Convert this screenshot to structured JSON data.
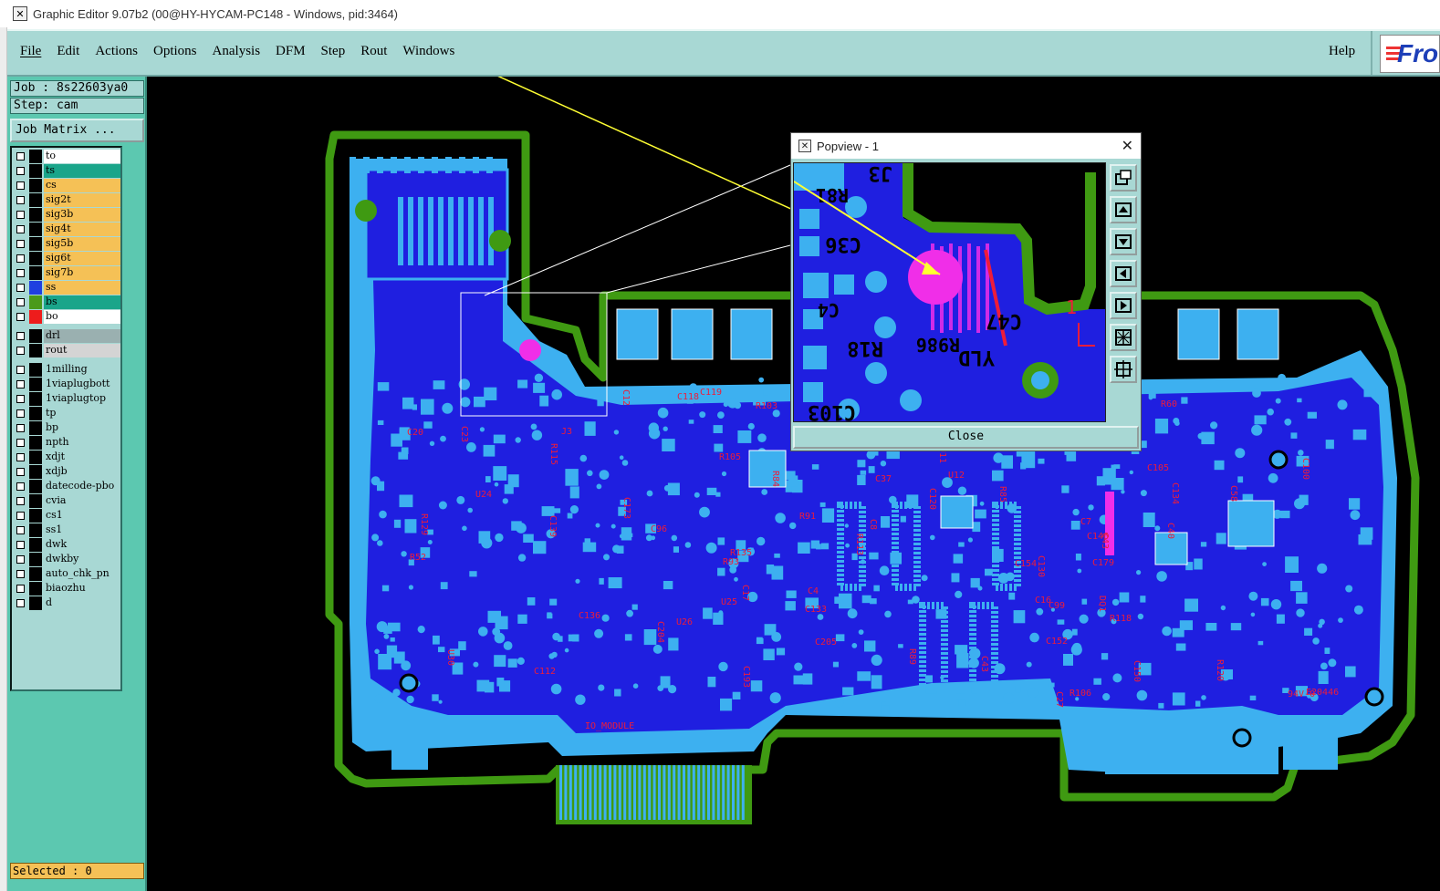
{
  "window": {
    "title": "Graphic Editor 9.07b2 (00@HY-HYCAM-PC148 - Windows, pid:3464)"
  },
  "menu": {
    "items": [
      "File",
      "Edit",
      "Actions",
      "Options",
      "Analysis",
      "DFM",
      "Step",
      "Rout",
      "Windows"
    ],
    "help": "Help",
    "logo_text": "Fro"
  },
  "info": {
    "job": "Job : 8s22603ya0",
    "step": "Step: cam",
    "job_matrix": "Job Matrix ..."
  },
  "layers": [
    {
      "name": "to",
      "color": "#ffffff"
    },
    {
      "name": "ts",
      "color": "#1aa58a"
    },
    {
      "name": "cs",
      "color": "#f5c156"
    },
    {
      "name": "sig2t",
      "color": "#f5c156"
    },
    {
      "name": "sig3b",
      "color": "#f5c156"
    },
    {
      "name": "sig4t",
      "color": "#f5c156"
    },
    {
      "name": "sig5b",
      "color": "#f5c156"
    },
    {
      "name": "sig6t",
      "color": "#f5c156"
    },
    {
      "name": "sig7b",
      "color": "#f5c156"
    },
    {
      "name": "ss",
      "color": "#f5c156",
      "swatch": "#1f3fe0"
    },
    {
      "name": "bs",
      "color": "#1aa58a",
      "swatch": "#4a9a1a"
    },
    {
      "name": "bo",
      "color": "#ffffff",
      "swatch": "#ee1c1c"
    },
    {
      "name": "drl",
      "color": "#9ab0b0"
    },
    {
      "name": "rout",
      "color": "#d4d4d4"
    },
    {
      "name": "1milling",
      "color": "#a8d8d4"
    },
    {
      "name": "1viaplugbott",
      "color": "#a8d8d4"
    },
    {
      "name": "1viaplugtop",
      "color": "#a8d8d4"
    },
    {
      "name": "tp",
      "color": "#a8d8d4"
    },
    {
      "name": "bp",
      "color": "#a8d8d4"
    },
    {
      "name": "npth",
      "color": "#a8d8d4"
    },
    {
      "name": "xdjt",
      "color": "#a8d8d4"
    },
    {
      "name": "xdjb",
      "color": "#a8d8d4"
    },
    {
      "name": "datecode-pbo",
      "color": "#a8d8d4"
    },
    {
      "name": "cvia",
      "color": "#a8d8d4"
    },
    {
      "name": "cs1",
      "color": "#a8d8d4"
    },
    {
      "name": "ss1",
      "color": "#a8d8d4"
    },
    {
      "name": "dwk",
      "color": "#a8d8d4"
    },
    {
      "name": "dwkby",
      "color": "#a8d8d4"
    },
    {
      "name": "auto_chk_pn",
      "color": "#a8d8d4"
    },
    {
      "name": "biaozhu",
      "color": "#a8d8d4"
    },
    {
      "name": "d",
      "color": "#a8d8d4"
    }
  ],
  "status": {
    "selected": "Selected : 0"
  },
  "popview": {
    "title": "Popview - 1",
    "close_label": "Close",
    "pcb_labels": [
      "J3",
      "R81",
      "C36",
      "C4",
      "R18",
      "C103",
      "R986",
      "C47",
      "YLD"
    ]
  },
  "board": {
    "labels": [
      "E20446",
      "94V-0",
      "R105",
      "C33",
      "J3",
      "C4",
      "R60",
      "C152",
      "C37",
      "C27",
      "C29",
      "C40",
      "R92",
      "R93",
      "U12",
      "C16",
      "C20",
      "C23",
      "C12",
      "C100",
      "U11",
      "C120",
      "C119",
      "C204",
      "R120",
      "C205",
      "C195",
      "C193",
      "R89",
      "R84",
      "C17",
      "C58",
      "U26",
      "U24",
      "C130",
      "C133",
      "C134",
      "C136",
      "R129",
      "R118",
      "R104",
      "R103",
      "C112",
      "C109",
      "R106",
      "C118",
      "C99",
      "C173",
      "R91",
      "R85",
      "C96",
      "C105",
      "R86",
      "R52",
      "C43",
      "C146",
      "C150",
      "C139",
      "R135",
      "DQ1",
      "R108",
      "C179",
      "R115",
      "R113",
      "U30",
      "U25",
      "C43",
      "C154",
      "C8",
      "C7",
      "U3"
    ],
    "title_module": "IO_MODULE"
  },
  "colors": {
    "panel": "#5cc8b0",
    "menubar": "#a8d8d4",
    "board_outline": "#3f9a12",
    "copper": "#1f1fe0",
    "pad": "#3db0f0",
    "silkscreen": "#ee1c3a",
    "marker": "#f02ee8"
  }
}
